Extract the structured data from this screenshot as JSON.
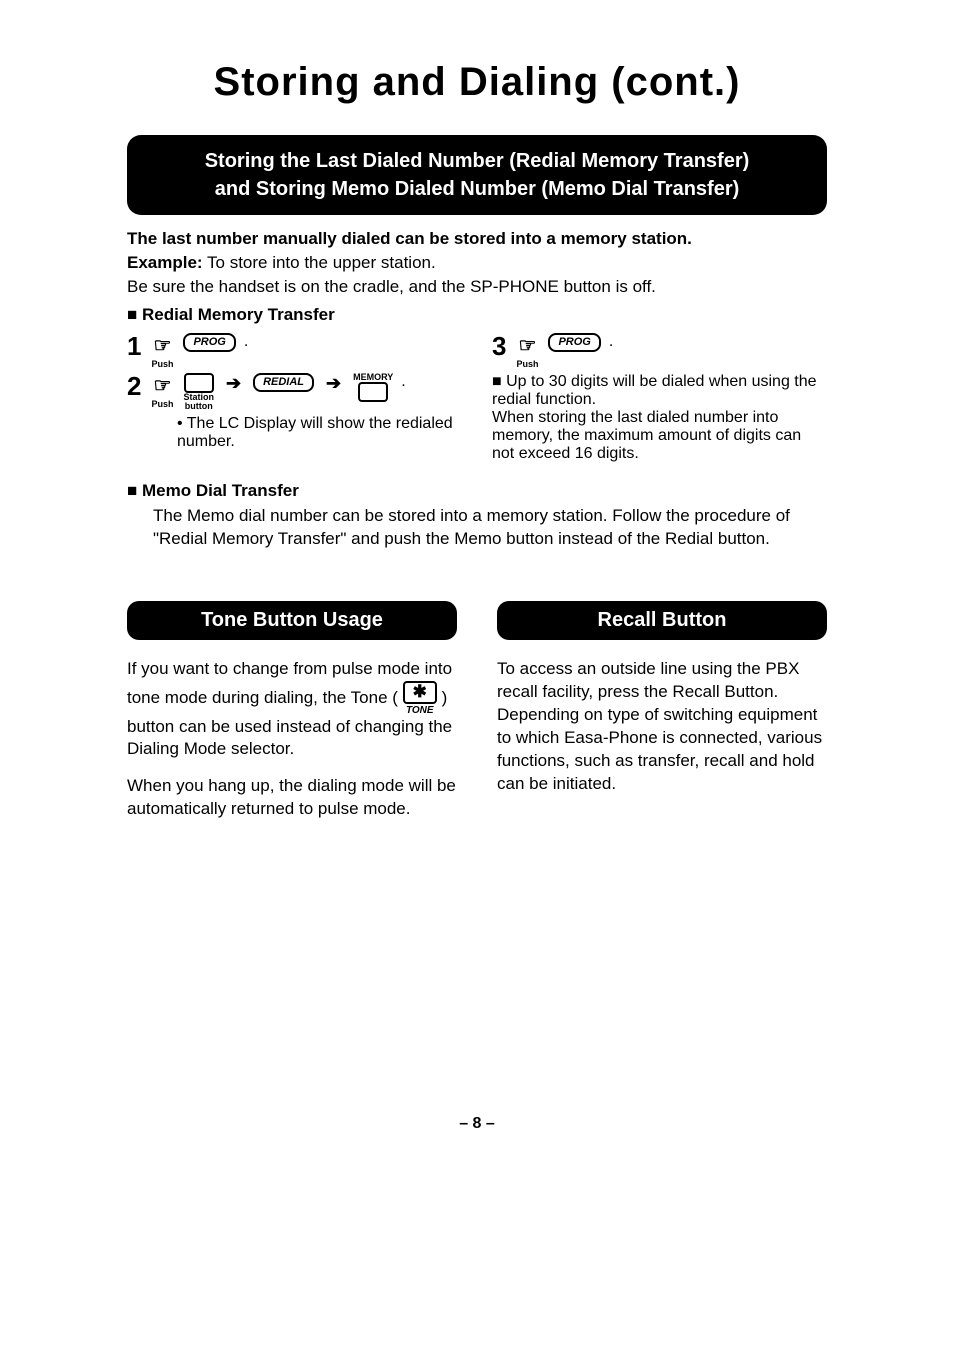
{
  "title": "Storing and Dialing (cont.)",
  "banner": {
    "line1": "Storing the Last Dialed Number (Redial Memory Transfer)",
    "line2": "and Storing Memo Dialed Number (Memo Dial Transfer)"
  },
  "intro": {
    "line1": "The last number manually dialed can be stored into a memory station.",
    "example_label": "Example:",
    "example_text": " To store into the upper station.",
    "line3": "Be sure the handset is on the cradle, and the SP-PHONE button is off."
  },
  "redial": {
    "heading": "Redial Memory Transfer",
    "steps": {
      "n1": "1",
      "n2": "2",
      "n3": "3",
      "push": "Push",
      "prog": "PROG",
      "station": "Station",
      "button": "button",
      "redial": "REDIAL",
      "memory": "MEMORY"
    },
    "note1": "The LC Display will show the redialed number.",
    "note2": "Up to 30 digits will be dialed when using the redial function.\nWhen storing the last dialed number into memory, the maximum amount of digits can not exceed 16 digits."
  },
  "memo": {
    "heading": "Memo Dial Transfer",
    "text": "The Memo dial number can be stored into a memory station. Follow the procedure of \"Redial Memory Transfer\" and push the Memo button instead of the Redial button."
  },
  "tone": {
    "heading": "Tone Button Usage",
    "p1a": "If you want to change from pulse mode into tone mode during dialing, the Tone ( ",
    "star": "✱",
    "tone_lbl": "TONE",
    "p1b": " ) button can be used instead of changing the Dialing Mode selector.",
    "p2": "When you hang up, the dialing mode will be automatically returned to pulse mode."
  },
  "recall": {
    "heading": "Recall Button",
    "p1": "To access an outside line using the PBX recall facility, press the Recall Button. Depending on type of switching equipment to which Easa-Phone is connected, various functions, such as transfer, recall and hold can be initiated."
  },
  "page_number": "– 8 –"
}
